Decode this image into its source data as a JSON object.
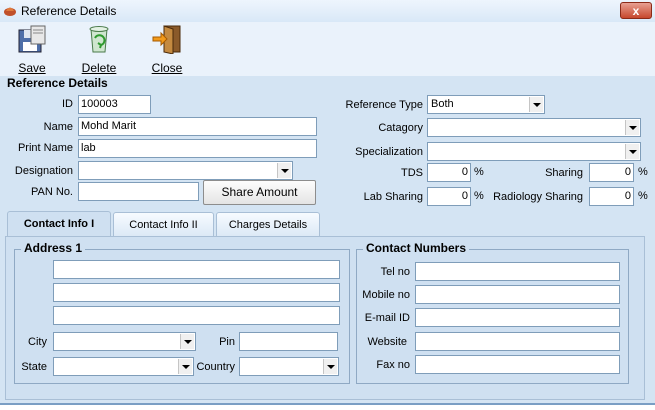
{
  "window": {
    "title": "Reference Details",
    "close_glyph": "x"
  },
  "toolbar": {
    "save": "Save",
    "delete": "Delete",
    "close": "Close"
  },
  "section_title": "Reference Details",
  "form": {
    "id_label": "ID",
    "id_value": "100003",
    "name_label": "Name",
    "name_value": "Mohd Marit",
    "print_name_label": "Print Name",
    "print_name_value": "lab",
    "designation_label": "Designation",
    "designation_value": "",
    "pan_label": "PAN No.",
    "pan_value": "",
    "share_amount_button": "Share Amount",
    "reference_type_label": "Reference Type",
    "reference_type_value": "Both",
    "category_label": "Catagory",
    "category_value": "",
    "specialization_label": "Specialization",
    "specialization_value": "",
    "tds_label": "TDS",
    "tds_value": "0",
    "sharing_label": "Sharing",
    "sharing_value": "0",
    "lab_sharing_label": "Lab Sharing",
    "lab_sharing_value": "0",
    "radiology_sharing_label": "Radiology Sharing",
    "radiology_sharing_value": "0",
    "pct": "%"
  },
  "tabs": [
    {
      "label": "Contact Info I",
      "active": true
    },
    {
      "label": "Contact Info II",
      "active": false
    },
    {
      "label": "Charges Details",
      "active": false
    }
  ],
  "address": {
    "group_title": "Address 1",
    "line1": "",
    "line2": "",
    "line3": "",
    "city_label": "City",
    "city_value": "",
    "pin_label": "Pin",
    "pin_value": "",
    "state_label": "State",
    "state_value": "",
    "country_label": "Country",
    "country_value": ""
  },
  "contact": {
    "group_title": "Contact Numbers",
    "tel_label": "Tel no",
    "tel_value": "",
    "mobile_label": "Mobile no",
    "mobile_value": "",
    "email_label": "E-mail ID",
    "email_value": "",
    "website_label": "Website",
    "website_value": "",
    "fax_label": "Fax no",
    "fax_value": ""
  },
  "icons": {
    "app": "app-icon",
    "save": "floppy-disk-icon",
    "delete": "recycle-bin-icon",
    "close": "exit-door-icon"
  }
}
